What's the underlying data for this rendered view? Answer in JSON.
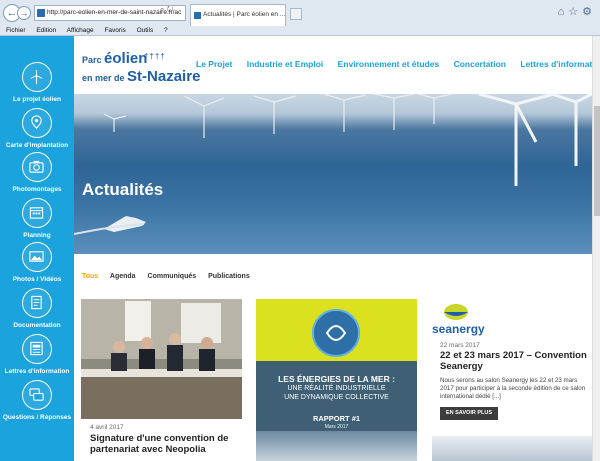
{
  "browser": {
    "url": "http://parc-eolien-en-mer-de-saint-nazaire.fr/ac",
    "tab_title": "Actualités | Parc éolien en ...",
    "menu": [
      "Fichier",
      "Edition",
      "Affichage",
      "Favoris",
      "Outils",
      "?"
    ]
  },
  "sidebar": {
    "items": [
      {
        "label": "Le projet éolien",
        "icon": "turbine-icon"
      },
      {
        "label": "Carte d'implantation",
        "icon": "map-pin-icon"
      },
      {
        "label": "Photomontages",
        "icon": "camera-icon"
      },
      {
        "label": "Planning",
        "icon": "calendar-icon"
      },
      {
        "label": "Photos / Vidéos",
        "icon": "photo-video-icon"
      },
      {
        "label": "Documentation",
        "icon": "document-icon"
      },
      {
        "label": "Lettres d'information",
        "icon": "newsletter-icon"
      },
      {
        "label": "Questions / Réponses",
        "icon": "chat-icon"
      }
    ]
  },
  "logo": {
    "line1_small": "Parc",
    "line1_big": "éolien",
    "line2_small": "en mer de",
    "line2_big": "St-Nazaire"
  },
  "nav": [
    "Le Projet",
    "Industrie et Emploi",
    "Environnement et études",
    "Concertation",
    "Lettres d'information"
  ],
  "hero": {
    "title": "Actualités"
  },
  "filters": [
    "Tous",
    "Agenda",
    "Communiqués",
    "Publications"
  ],
  "cards": {
    "card1": {
      "date": "4 avril 2017",
      "title": "Signature d'une convention de partenariat avec Neopolia"
    },
    "card2": {
      "line1": "LES ÉNERGIES DE LA MER :",
      "line2": "UNE RÉALITÉ INDUSTRIELLE",
      "line3": "UNE DYNAMIQUE COLLECTIVE",
      "rapport": "RAPPORT #1",
      "rapport_date": "Mars 2017"
    },
    "card3": {
      "logo_text": "seanergy",
      "date": "22 mars 2017",
      "title": "22 et 23 mars 2017 – Convention Seanergy",
      "description": "Nous serons au salon Seanergy les 22 et 23 mars 2017 pour participer à la seconde édition de ce salon international dédié [...]",
      "button": "EN SAVOIR PLUS"
    }
  },
  "colors": {
    "accent": "#1ba3dd",
    "brand": "#1f5fa8",
    "active_filter": "#f5a400"
  }
}
